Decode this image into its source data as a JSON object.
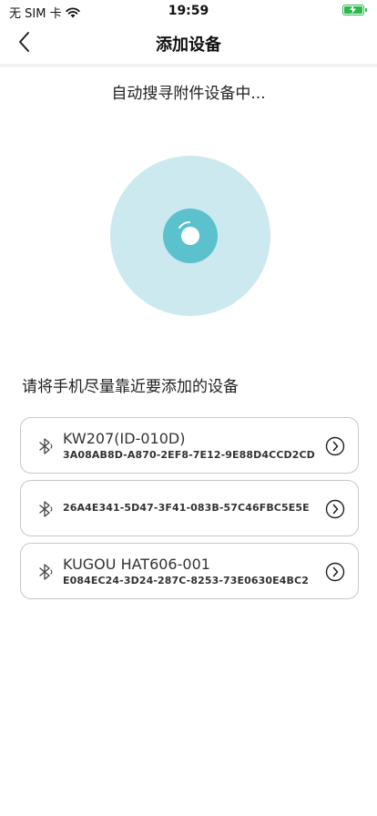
{
  "status": {
    "carrier": "无 SIM 卡",
    "time": "19:59",
    "battery_level": 1.0,
    "charging": true
  },
  "nav": {
    "title": "添加设备"
  },
  "searching_text": "自动搜寻附件设备中...",
  "hint_text": "请将手机尽量靠近要添加的设备",
  "devices": [
    {
      "name": "KW207(ID-010D)",
      "id": "3A08AB8D-A870-2EF8-7E12-9E88D4CCD2CD"
    },
    {
      "name": "",
      "id": "26A4E341-5D47-3F41-083B-57C46FBC5E5E"
    },
    {
      "name": "KUGOU HAT606-001",
      "id": "E084EC24-3D24-287C-8253-73E0630E4BC2"
    }
  ],
  "colors": {
    "scan_outer": "#cbe9ee",
    "scan_inner": "#5bc1cc",
    "battery": "#2db84d"
  },
  "icons": {
    "back": "chevron-left-icon",
    "wifi": "wifi-icon",
    "battery": "battery-charging-icon",
    "device": "bluetooth-icon",
    "open": "chevron-right-circle-icon"
  }
}
